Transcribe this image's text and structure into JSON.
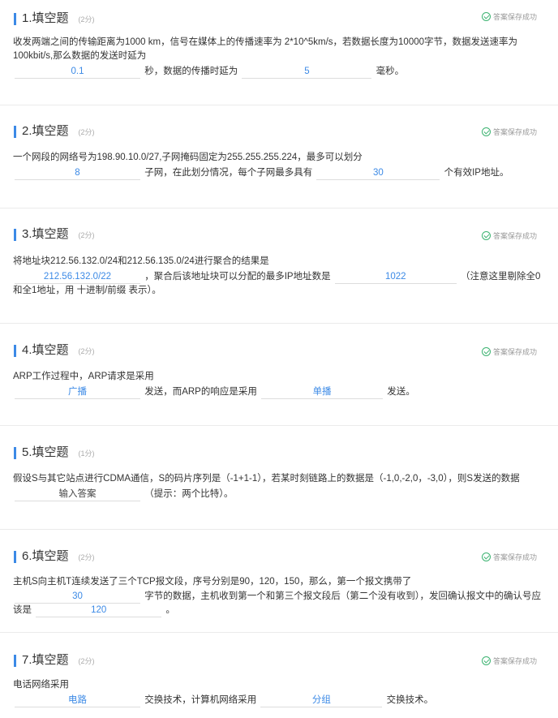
{
  "saved_label": "答案保存成功",
  "questions": [
    {
      "title": "1.填空题",
      "score": "(2分)",
      "text1": "收发两端之间的传输距离为1000 km，信号在媒体上的传播速率为 2*10^5km/s，若数据长度为10000字节，数据发送速率为100kbit/s,那么数据的发送时延为",
      "blank1": "0.1",
      "text2": "秒，数据的传播时延为",
      "blank2": "5",
      "text3": "毫秒。"
    },
    {
      "title": "2.填空题",
      "score": "(2分)",
      "text1": "一个网段的网络号为198.90.10.0/27,子网掩码固定为255.255.255.224，最多可以划分",
      "blank1": "8",
      "text2": "子网，在此划分情况，每个子网最多具有",
      "blank2": "30",
      "text3": "个有效IP地址。"
    },
    {
      "title": "3.填空题",
      "score": "(2分)",
      "text1": "将地址块212.56.132.0/24和212.56.135.0/24进行聚合的结果是",
      "blank1": "212.56.132.0/22",
      "text2": "，聚合后该地址块可以分配的最多IP地址数是",
      "blank2": "1022",
      "text3": "（注意这里剔除全0和全1地址，用 十进制/前缀 表示）。"
    },
    {
      "title": "4.填空题",
      "score": "(2分)",
      "text1": "ARP工作过程中，ARP请求是采用",
      "blank1": "广播",
      "text2": "发送，而ARP的响应是采用",
      "blank2": "单播",
      "text3": "发送。"
    },
    {
      "title": "5.填空题",
      "score": "(1分)",
      "text1": "假设S与其它站点进行CDMA通信，S的码片序列是（-1+1-1），若某时刻链路上的数据是（-1,0,-2,0，-3,0），则S发送的数据",
      "blank1": "输入答案",
      "text2": "（提示：两个比特）。"
    },
    {
      "title": "6.填空题",
      "score": "(2分)",
      "text1": "主机S向主机T连续发送了三个TCP报文段，序号分别是90，120，150，那么，第一个报文携带了",
      "blank1": "30",
      "text2": "字节的数据，主机收到第一个和第三个报文段后（第二个没有收到），发回确认报文中的确认号应该是",
      "blank2": "120",
      "text3": "。"
    },
    {
      "title": "7.填空题",
      "score": "(2分)",
      "text1": "电话网络采用",
      "blank1": "电路",
      "text2": "交换技术，计算机网络采用",
      "blank2": "分组",
      "text3": "交换技术。"
    }
  ]
}
